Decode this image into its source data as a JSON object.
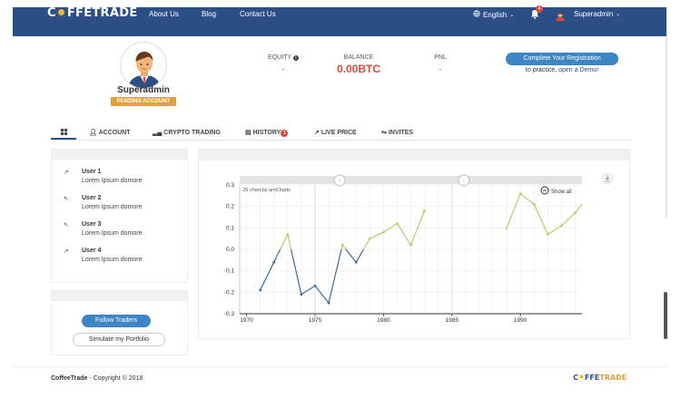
{
  "brand": {
    "logo_parts": [
      "C",
      "FFE",
      "TRADE"
    ],
    "brand_color": "#2c4f86",
    "accent_color": "#f2b43a"
  },
  "nav": {
    "links": [
      "About Us",
      "Blog",
      "Contact Us"
    ],
    "language": "English",
    "notifications_count": "4",
    "user_name": "Superadmin"
  },
  "profile": {
    "name": "Superadmin",
    "status_badge": "PENDING ACCOUNT"
  },
  "stats": {
    "equity_label": "EQUITY",
    "equity_value": "-",
    "balance_label": "BALANCE",
    "balance_value": "0.00BTC",
    "pnl_label": "PNL",
    "pnl_value": "-"
  },
  "registration": {
    "button_label": "Complete Your Registration",
    "sub_prefix": "to practice, ",
    "sub_link": "open a Demo!"
  },
  "tabs": [
    {
      "icon": "grid-icon",
      "label": ""
    },
    {
      "icon": "user-icon",
      "label": "ACCOUNT"
    },
    {
      "icon": "bar-chart-icon",
      "label": "CRYPTO TRADING"
    },
    {
      "icon": "history-icon",
      "label": "HISTORY",
      "badge": "1"
    },
    {
      "icon": "trend-icon",
      "label": "LIVE PRICE"
    },
    {
      "icon": "share-icon",
      "label": "INVITES"
    }
  ],
  "users": [
    {
      "name": "User 1",
      "desc": "Lorem Ipsum domore",
      "arrow": "↗"
    },
    {
      "name": "User 2",
      "desc": "Lorem Ipsum domore",
      "arrow": "↖"
    },
    {
      "name": "User 3",
      "desc": "Lorem Ipsum domore",
      "arrow": "↖"
    },
    {
      "name": "User 4",
      "desc": "Lorem Ipsum domore",
      "arrow": "↗"
    }
  ],
  "actions": {
    "follow_label": "Follow Traders",
    "simulate_label": "Simulate my Portfolio"
  },
  "chart": {
    "credit": "JS chart by amCharts",
    "show_all": "Show all"
  },
  "chart_data": {
    "type": "line",
    "title": "",
    "xlabel": "",
    "ylabel": "",
    "xlim": [
      1969.5,
      1994.5
    ],
    "ylim": [
      -0.3,
      0.3
    ],
    "x_ticks": [
      1970,
      1975,
      1980,
      1985,
      1990
    ],
    "y_ticks": [
      0.3,
      0.2,
      0.1,
      0.0,
      -0.1,
      -0.2,
      -0.3
    ],
    "negative_color": "#3d6c9e",
    "positive_color": "#b5cf6b",
    "series": [
      {
        "points": [
          [
            1971,
            -0.19
          ],
          [
            1972,
            -0.06
          ],
          [
            1973,
            0.07
          ],
          [
            1974,
            -0.21
          ],
          [
            1975,
            -0.17
          ],
          [
            1976,
            -0.25
          ],
          [
            1977,
            0.02
          ],
          [
            1978,
            -0.06
          ],
          [
            1979,
            0.05
          ],
          [
            1980,
            0.08
          ],
          [
            1981,
            0.12
          ],
          [
            1982,
            0.02
          ],
          [
            1983,
            0.18
          ]
        ]
      },
      {
        "points": [
          [
            1989,
            0.1
          ],
          [
            1990,
            0.26
          ],
          [
            1991,
            0.21
          ],
          [
            1992,
            0.07
          ],
          [
            1993,
            0.11
          ],
          [
            1994,
            0.17
          ],
          [
            1994.5,
            0.21
          ]
        ]
      }
    ]
  },
  "footer": {
    "brand": "CoffeeTrade",
    "copyright": " - Copyright © 2018",
    "logo_parts": [
      "C",
      "FFE",
      "TRADE"
    ]
  }
}
